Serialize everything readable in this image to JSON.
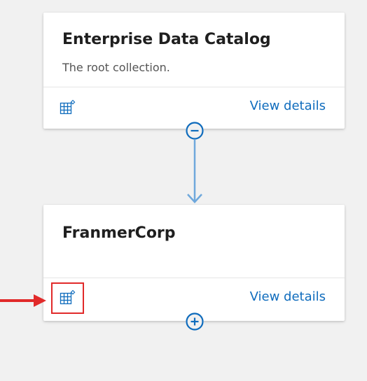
{
  "colors": {
    "background": "#f1f1f1",
    "card": "#ffffff",
    "link": "#0f6cbd",
    "icon": "#0f6cbd",
    "connector": "#6fa8dc",
    "highlight": "#e12a2a"
  },
  "collections": [
    {
      "title": "Enterprise Data Catalog",
      "description": "The root collection.",
      "link_label": "View details",
      "icon": "grid-sparkle-icon",
      "toggle_icon": "collapse-minus-icon"
    },
    {
      "title": "FranmerCorp",
      "description": "",
      "link_label": "View details",
      "icon": "grid-sparkle-icon",
      "toggle_icon": "expand-plus-icon"
    }
  ],
  "annotation": {
    "highlight_target": "grid-sparkle-icon",
    "pointer": "red-arrow-icon"
  }
}
